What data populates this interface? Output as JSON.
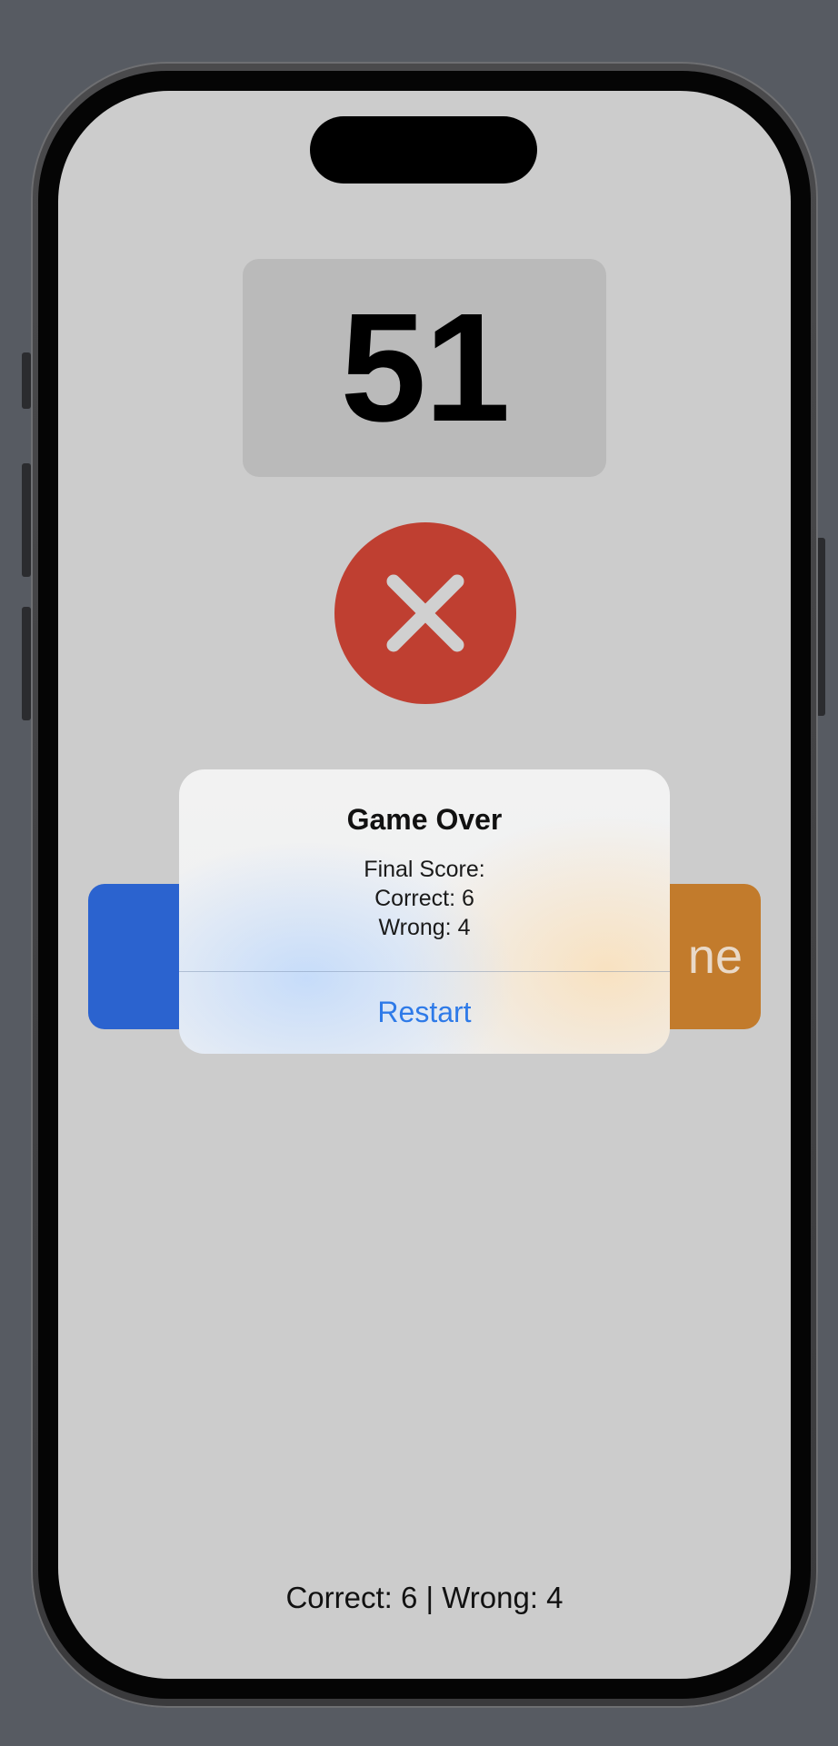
{
  "game": {
    "current_number": "51",
    "result_icon": "x-mark-icon",
    "answer_right_label_partial": "ne",
    "answer_left_label_partial": ""
  },
  "alert": {
    "title": "Game Over",
    "final_score_label": "Final Score:",
    "correct_line": "Correct: 6",
    "wrong_line": "Wrong: 4",
    "action_label": "Restart"
  },
  "footer": {
    "score_text": "Correct: 6 | Wrong: 4"
  },
  "colors": {
    "background": "#575b62",
    "screen": "#cccccc",
    "wrong_indicator": "#bf3f31",
    "left_button": "#2b63cf",
    "right_button": "#c27b2c",
    "alert_action": "#2e7ae8"
  }
}
